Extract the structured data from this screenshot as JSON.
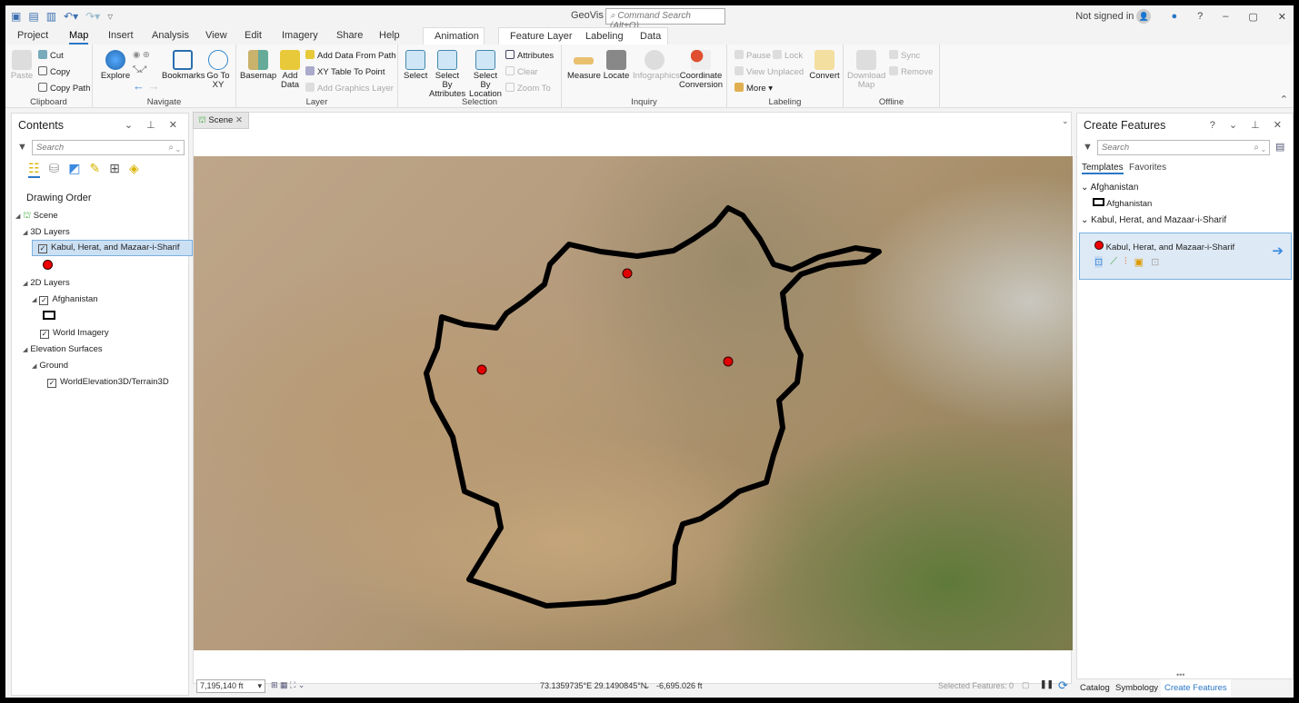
{
  "app": {
    "title": "GeoVis",
    "command_search_placeholder": "Command Search (Alt+Q)",
    "signed_in": "Not signed in"
  },
  "ribbon_tabs": [
    "Project",
    "Map",
    "Insert",
    "Analysis",
    "View",
    "Edit",
    "Imagery",
    "Share",
    "Help"
  ],
  "active_tab": "Map",
  "contextual_tabs": [
    "Animation",
    "Feature Layer",
    "Labeling",
    "Data"
  ],
  "groups": {
    "clipboard": {
      "label": "Clipboard",
      "paste": "Paste",
      "cut": "Cut",
      "copy": "Copy",
      "copy_path": "Copy Path"
    },
    "navigate": {
      "label": "Navigate",
      "explore": "Explore",
      "bookmarks": "Bookmarks",
      "go_to_xy": "Go To XY"
    },
    "layer": {
      "label": "Layer",
      "basemap": "Basemap",
      "add_data": "Add Data",
      "add_data_from_path": "Add Data From Path",
      "xy_table": "XY Table To Point",
      "add_graphics": "Add Graphics Layer"
    },
    "selection": {
      "label": "Selection",
      "select": "Select",
      "by_attributes": "Select By Attributes",
      "by_location": "Select By Location",
      "attributes": "Attributes",
      "clear": "Clear",
      "zoom_to": "Zoom To"
    },
    "inquiry": {
      "label": "Inquiry",
      "measure": "Measure",
      "locate": "Locate",
      "infographics": "Infographics",
      "coord": "Coordinate Conversion"
    },
    "labeling": {
      "label": "Labeling",
      "pause": "Pause",
      "lock": "Lock",
      "view_unplaced": "View Unplaced",
      "more": "More",
      "convert": "Convert"
    },
    "offline": {
      "label": "Offline",
      "download": "Download Map",
      "sync": "Sync",
      "remove": "Remove"
    }
  },
  "contents": {
    "title": "Contents",
    "search_placeholder": "Search",
    "heading": "Drawing Order",
    "scene": "Scene",
    "layers3d": "3D Layers",
    "cities": "Kabul, Herat, and Mazaar-i-Sharif",
    "layers2d": "2D Layers",
    "afghanistan": "Afghanistan",
    "imagery": "World Imagery",
    "elevation": "Elevation Surfaces",
    "ground": "Ground",
    "terrain": "WorldElevation3D/Terrain3D"
  },
  "scene_tab": "Scene",
  "map": {
    "cities_color": "#e00000",
    "boundary_color": "#000000"
  },
  "status": {
    "scale": "7,195,140 ft",
    "coords": "73.1359735°E 29.1490845°N",
    "elev": "-6,695.026 ft",
    "selected": "Selected Features: 0"
  },
  "create": {
    "title": "Create Features",
    "search_placeholder": "Search",
    "tab_templates": "Templates",
    "tab_favorites": "Favorites",
    "group1": "Afghanistan",
    "item1": "Afghanistan",
    "group2": "Kabul, Herat, and Mazaar-i-Sharif",
    "item2": "Kabul, Herat, and Mazaar-i-Sharif"
  },
  "bottom_tabs": [
    "Catalog",
    "Symbology",
    "Create Features"
  ],
  "accent": "#2a78c6"
}
